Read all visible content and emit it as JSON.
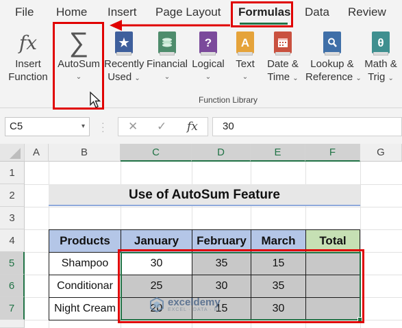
{
  "ribbon": {
    "tabs": [
      "File",
      "Home",
      "Insert",
      "Page Layout",
      "Formulas",
      "Data",
      "Review"
    ],
    "active_tab": "Formulas",
    "buttons": [
      {
        "icon": "fx-icon",
        "line1": "Insert",
        "line2": "Function"
      },
      {
        "icon": "sigma-icon",
        "line1": "AutoSum",
        "line2": ""
      },
      {
        "icon": "star-book-icon",
        "line1": "Recently",
        "line2": "Used"
      },
      {
        "icon": "money-book-icon",
        "line1": "Financial",
        "line2": ""
      },
      {
        "icon": "question-book-icon",
        "line1": "Logical",
        "line2": ""
      },
      {
        "icon": "text-book-icon",
        "line1": "Text",
        "line2": ""
      },
      {
        "icon": "calendar-book-icon",
        "line1": "Date &",
        "line2": "Time"
      },
      {
        "icon": "search-book-icon",
        "line1": "Lookup &",
        "line2": "Reference"
      },
      {
        "icon": "theta-book-icon",
        "line1": "Math &",
        "line2": "Trig"
      }
    ],
    "icon_glyphs": {
      "fx": "fx",
      "sigma": "∑",
      "star": "★",
      "question": "?",
      "text": "A",
      "theta": "θ"
    },
    "group_label": "Function Library"
  },
  "formula_bar": {
    "name_box": "C5",
    "cancel_glyph": "✕",
    "enter_glyph": "✓",
    "fx_glyph": "fx",
    "value": "30"
  },
  "sheet": {
    "columns": [
      "A",
      "B",
      "C",
      "D",
      "E",
      "F",
      "G"
    ],
    "rows": [
      "1",
      "2",
      "3",
      "4",
      "5",
      "6",
      "7"
    ],
    "title": "Use of AutoSum Feature",
    "headers": [
      "Products",
      "January",
      "February",
      "March",
      "Total"
    ],
    "data": [
      [
        "Shampoo",
        "30",
        "35",
        "15",
        ""
      ],
      [
        "Conditionar",
        "25",
        "30",
        "35",
        ""
      ],
      [
        "Night Cream",
        "20",
        "15",
        "30",
        ""
      ]
    ]
  },
  "watermark": {
    "name": "exceldemy",
    "tagline": "EXCEL · DATA · BI"
  },
  "colors": {
    "accent_green": "#217346",
    "header_blue": "#b4c6e7",
    "total_green": "#c6e0b4",
    "highlight_red": "#e00000"
  }
}
